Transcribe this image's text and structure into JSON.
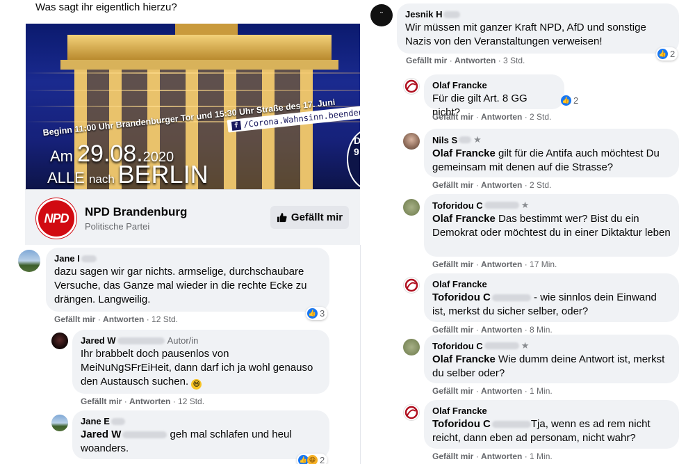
{
  "post": {
    "text": "Was sagt ihr eigentlich hierzu?",
    "banner": {
      "fb_badge": "/Corona.Wahnsinn.beenden",
      "line1": "Beginn 11:00 Uhr Brandenburger Tor und 15:30 Uhr Straße des 17. Juni",
      "date_am": "Am ",
      "date_num": "29.08.",
      "date_year": "2020",
      "alle": "ALLE ",
      "nach": "nach ",
      "berlin": "BERLIN",
      "circle_text": "D\n9"
    },
    "page": {
      "logo_text": "NPD",
      "name": "NPD Brandenburg",
      "category": "Politische Partei",
      "like_button": "Gefällt mir"
    }
  },
  "labels": {
    "like": "Gefällt mir",
    "reply": "Antworten",
    "sep": " · "
  },
  "comments_left": [
    {
      "name": "Jane I",
      "text": "dazu sagen wir gar nichts. armselige, durchschaubare Versuche, das Ganze mal wieder in die rechte Ecke zu drängen. Langweilig.",
      "time": "12 Std.",
      "reactions": "3"
    },
    {
      "name": "Jared W",
      "author_tag": "Autor/in",
      "text": "Ihr brabbelt doch pausenlos von MeiNuNgSFrEiHeit, dann darf ich ja wohl genauso den Austausch suchen.",
      "emoji": "😄",
      "time": "12 Std."
    },
    {
      "name": "Jane E",
      "mention": "Jared W",
      "text": " geh mal schlafen und heul woanders.",
      "reactions": "2"
    }
  ],
  "comments_right": [
    {
      "name": "Jesnik H",
      "text": "Wir müssen mit ganzer Kraft NPD, AfD und sonstige Nazis von den Veranstaltungen verweisen!",
      "time": "3 Std.",
      "reactions": "2"
    },
    {
      "name": "Olaf Francke",
      "text": "Für die gilt Art. 8 GG nicht?",
      "time": "2 Std.",
      "reactions": "2"
    },
    {
      "name": "Nils S",
      "mention": "Olaf Francke",
      "text": " gilt für die Antifa auch möchtest Du gemeinsam mit denen auf die Strasse?",
      "time": "2 Std."
    },
    {
      "name": "Toforidou C",
      "mention": "Olaf Francke",
      "text": " Das bestimmt wer? Bist du ein Demokrat oder möchtest du in einer Diktaktur leben",
      "time": "17 Min."
    },
    {
      "name": "Olaf Francke",
      "mention": "Toforidou C",
      "text": " - wie sinnlos dein Einwand ist, merkst du sicher selber, oder?",
      "time": "8 Min."
    },
    {
      "name": "Toforidou C",
      "mention": "Olaf Francke",
      "text": " Wie dumm deine Antwort ist, merkst du selber oder?",
      "time": "1 Min."
    },
    {
      "name": "Olaf Francke",
      "mention": "Toforidou C",
      "text": "Tja, wenn es ad rem nicht reicht, dann eben ad personam, nicht wahr?",
      "time": "1 Min."
    }
  ],
  "colors": {
    "npd_red": "#d10a11",
    "bubble": "#f0f2f5",
    "meta": "#65676b",
    "like_blue": "#1877f2"
  }
}
